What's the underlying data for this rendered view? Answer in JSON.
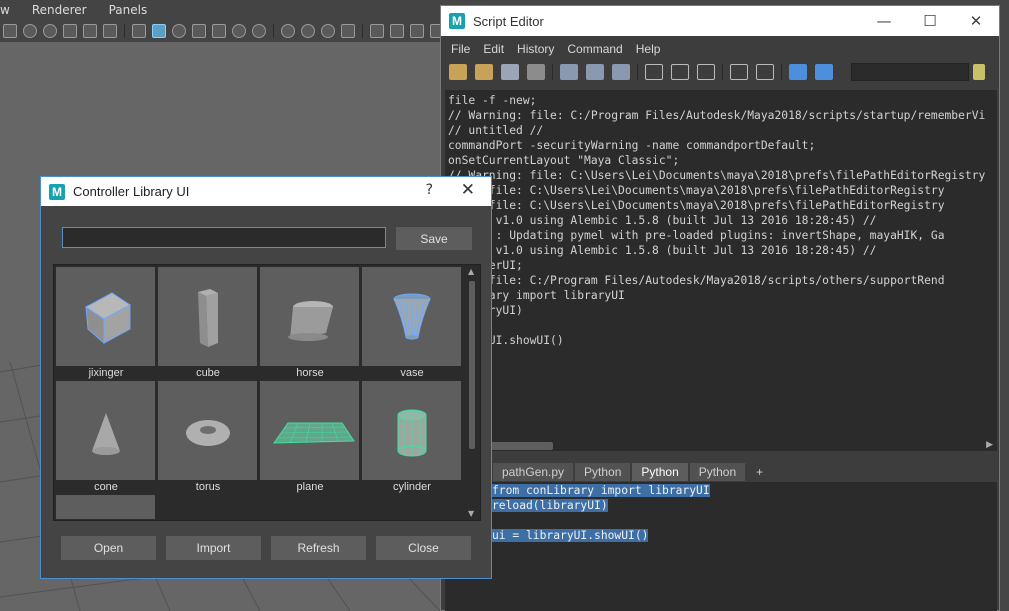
{
  "maya": {
    "menu": [
      "w",
      "Renderer",
      "Panels"
    ]
  },
  "script_editor": {
    "title": "Script Editor",
    "window_buttons": {
      "minimize": "—",
      "maximize": "☐",
      "close": "✕"
    },
    "menu": [
      "File",
      "Edit",
      "History",
      "Command",
      "Help"
    ],
    "output_lines": [
      "file -f -new;",
      "// Warning: file: C:/Program Files/Autodesk/Maya2018/scripts/startup/rememberVi",
      "// untitled //",
      "commandPort -securityWarning -name commandportDefault;",
      "onSetCurrentLayout \"Maya Classic\";",
      "// Warning: file: C:\\Users\\Lei\\Documents\\maya\\2018\\prefs\\filePathEditorRegistry",
      "ning: file: C:\\Users\\Lei\\Documents\\maya\\2018\\prefs\\filePathEditorRegistry",
      "ning: file: C:\\Users\\Lei\\Documents\\maya\\2018\\prefs\\filePathEditorRegistry",
      "Export v1.0 using Alembic 1.5.8 (built Jul 13 2016 18:28:45) //",
      "l.core : Updating pymel with pre-loaded plugins: invertShape, mayaHIK, Ga",
      "Import v1.0 using Alembic 1.5.8 (built Jul 13 2016 18:28:45) //",
      "RendererUI;",
      "ning: file: C:/Program Files/Autodesk/Maya2018/scripts/others/supportRend",
      "onLibrary import libraryUI",
      "(libraryUI)",
      "",
      "ibraryUI.showUI()"
    ],
    "tabs": [
      {
        "label": "pathGen.py",
        "active": false
      },
      {
        "label": "Python",
        "active": false
      },
      {
        "label": "Python",
        "active": true
      },
      {
        "label": "Python",
        "active": false
      },
      {
        "label": "+",
        "active": false
      }
    ],
    "input_lines": [
      "from conLibrary import libraryUI",
      "reload(libraryUI)",
      "",
      "ui = libraryUI.showUI()"
    ]
  },
  "library_ui": {
    "title": "Controller Library UI",
    "help": "?",
    "close": "✕",
    "name_input_value": "",
    "save_label": "Save",
    "items": [
      {
        "label": "jixinger",
        "shape": "jixinger"
      },
      {
        "label": "cube",
        "shape": "cube"
      },
      {
        "label": "horse",
        "shape": "horse"
      },
      {
        "label": "vase",
        "shape": "vase"
      },
      {
        "label": "cone",
        "shape": "cone"
      },
      {
        "label": "torus",
        "shape": "torus"
      },
      {
        "label": "plane",
        "shape": "plane"
      },
      {
        "label": "cylinder",
        "shape": "cylinder"
      }
    ],
    "buttons": {
      "open": "Open",
      "import": "Import",
      "refresh": "Refresh",
      "close": "Close"
    }
  },
  "colors": {
    "maya_logo": "#17a2b0",
    "selection_highlight": "#3d6fa6",
    "focus_border": "#4a8fd0",
    "wireframe_green": "#3fe0a0",
    "wireframe_blue": "#6fa8ff"
  }
}
